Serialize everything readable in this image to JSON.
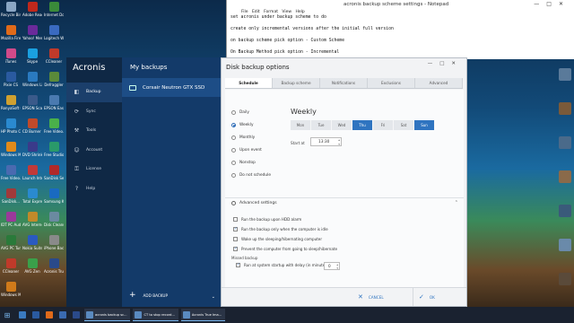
{
  "desktop": {
    "icons_left": [
      {
        "label": "Recycle Bin",
        "color": "#8aa6c4"
      },
      {
        "label": "Adobe Reader XI",
        "color": "#c0281c"
      },
      {
        "label": "Internet Downloa...",
        "color": "#3a8a3a"
      },
      {
        "label": "Mozilla Firefox",
        "color": "#e06a1a"
      },
      {
        "label": "Yahoo! Messenger",
        "color": "#6a2a9a"
      },
      {
        "label": "Logitech Webcam...",
        "color": "#3a6ac0"
      },
      {
        "label": "iTunes",
        "color": "#d04a8a"
      },
      {
        "label": "Skype",
        "color": "#1aa0e0"
      },
      {
        "label": "CCleaner",
        "color": "#c03a2a"
      },
      {
        "label": "Pixie CS",
        "color": "#2a5aa0"
      },
      {
        "label": "Windows Live Mail",
        "color": "#2a7ac0"
      },
      {
        "label": "Defraggler",
        "color": "#5a8a3a"
      },
      {
        "label": "RonyaSoft CD DVD...",
        "color": "#d0a030"
      },
      {
        "label": "EPSON Scan",
        "color": "#3a5a8a"
      },
      {
        "label": "EPSON Easy...",
        "color": "#4a7ab0"
      },
      {
        "label": "HP Photo Creations",
        "color": "#2a8ad0"
      },
      {
        "label": "CD Burner XP",
        "color": "#c04a2a"
      },
      {
        "label": "Free Video...",
        "color": "#4ab04a"
      },
      {
        "label": "Windows Media...",
        "color": "#e08a1a"
      },
      {
        "label": "DVD Shrink 3.2",
        "color": "#3a3a8a"
      },
      {
        "label": "Free Studio",
        "color": "#2a9a6a"
      },
      {
        "label": "Free Video... Dub",
        "color": "#4a6ab0"
      },
      {
        "label": "Launch Internet...",
        "color": "#c03a3a"
      },
      {
        "label": "SanDisk SecureAccess",
        "color": "#b02a2a"
      },
      {
        "label": "SanDisk...",
        "color": "#a03a3a"
      },
      {
        "label": "Total Express",
        "color": "#2a8ad0"
      },
      {
        "label": "Samsung Kies",
        "color": "#1a6ac0"
      },
      {
        "label": "IDT PC Audio",
        "color": "#9a3a9a"
      },
      {
        "label": "AVG Internet Security",
        "color": "#c08a2a"
      },
      {
        "label": "Disk Cleanup",
        "color": "#6a8aa0"
      },
      {
        "label": "AVG PC Tuneup",
        "color": "#2a7a3a"
      },
      {
        "label": "Nokia Suite",
        "color": "#2a5ac0"
      },
      {
        "label": "iPhone Backup",
        "color": "#8a8a8a"
      },
      {
        "label": "CCleaner",
        "color": "#c03a2a"
      },
      {
        "label": "AVG Zen",
        "color": "#3aa04a"
      },
      {
        "label": "Acronis True Image...",
        "color": "#2a4a8a"
      },
      {
        "label": "Windows Media...",
        "color": "#d07a1a"
      }
    ],
    "icons_right": [
      {
        "label": "",
        "color": "#5a7a9a"
      },
      {
        "label": "",
        "color": "#7a5a3a"
      },
      {
        "label": "",
        "color": "#4a6a8a"
      },
      {
        "label": "",
        "color": "#8a6a4a"
      },
      {
        "label": "",
        "color": "#3a5a7a"
      },
      {
        "label": "",
        "color": "#6a8aaa"
      },
      {
        "label": "",
        "color": "#5a4a3a"
      }
    ]
  },
  "notepad": {
    "title": "acronis backup scheme settings - Notepad",
    "menu": "File  Edit  Format  View  Help",
    "lines": [
      "set acronis under backup scheme to do",
      "",
      "create only incremental versions after the initial full version",
      "",
      "on backup scheme pick option - Custom Scheme",
      "",
      "On Backup Method pick option - Incremental"
    ]
  },
  "acronis": {
    "logo": "Acronis",
    "sidebar": [
      {
        "label": "Backup",
        "icon": "backup-icon",
        "glyph": "◧",
        "active": true
      },
      {
        "label": "Sync",
        "icon": "sync-icon",
        "glyph": "⟳",
        "active": false
      },
      {
        "label": "Tools",
        "icon": "tools-icon",
        "glyph": "⚒",
        "active": false
      },
      {
        "label": "Account",
        "icon": "account-icon",
        "glyph": "☺",
        "active": false
      },
      {
        "label": "License",
        "icon": "license-icon",
        "glyph": "⚿",
        "active": false
      },
      {
        "label": "Help",
        "icon": "help-icon",
        "glyph": "?",
        "active": false
      }
    ],
    "list_title": "My backups",
    "backup_item": "Corsair Neutron GTX SSD",
    "add_backup": "ADD BACKUP"
  },
  "dialog": {
    "title": "Disk backup options",
    "tabs": [
      {
        "label": "Schedule",
        "active": true
      },
      {
        "label": "Backup scheme",
        "active": false
      },
      {
        "label": "Notifications",
        "active": false
      },
      {
        "label": "Exclusions",
        "active": false
      },
      {
        "label": "Advanced",
        "active": false
      }
    ],
    "schedule_options": [
      {
        "label": "Daily",
        "selected": false
      },
      {
        "label": "Weekly",
        "selected": true
      },
      {
        "label": "Monthly",
        "selected": false
      },
      {
        "label": "Upon event",
        "selected": false
      },
      {
        "label": "Nonstop",
        "selected": false
      },
      {
        "label": "Do not schedule",
        "selected": false
      }
    ],
    "frequency_heading": "Weekly",
    "days": [
      {
        "label": "Mon",
        "selected": false
      },
      {
        "label": "Tue",
        "selected": false
      },
      {
        "label": "Wed",
        "selected": false
      },
      {
        "label": "Thu",
        "selected": true
      },
      {
        "label": "Fri",
        "selected": false
      },
      {
        "label": "Sat",
        "selected": false
      },
      {
        "label": "Sun",
        "selected": true
      }
    ],
    "start_at_label": "Start at",
    "start_at_value": "13:30",
    "advanced_header": "Advanced settings",
    "advanced_options": [
      {
        "label": "Run the backup upon HDD alarm",
        "checked": false
      },
      {
        "label": "Run the backup only when the computer is idle",
        "checked": true
      },
      {
        "label": "Wake up the sleeping/hibernating computer",
        "checked": false
      },
      {
        "label": "Prevent the computer from going to sleep/hibernate",
        "checked": true
      }
    ],
    "missed_label": "Missed backup",
    "missed_option": {
      "label": "Run at system startup with delay (in minutes)",
      "checked": true
    },
    "delay_value": "0",
    "cancel_label": "CANCEL",
    "ok_label": "OK"
  },
  "taskbar": {
    "apps": [
      {
        "label": "",
        "color": "#3a7ac0"
      },
      {
        "label": "",
        "color": "#2a5aa0"
      },
      {
        "label": "",
        "color": "#e06a1a"
      },
      {
        "label": "",
        "color": "#3a6ab0"
      },
      {
        "label": "",
        "color": "#2a4a8a"
      }
    ],
    "windows": [
      {
        "label": "acronis backup sc..."
      },
      {
        "label": "CT to stop record..."
      },
      {
        "label": "Acronis True Ima..."
      }
    ],
    "time": "",
    "date": ""
  },
  "colors": {
    "accent": "#2f74c0",
    "sidebar_bg": "#0f2845",
    "list_bg": "#133a69"
  }
}
